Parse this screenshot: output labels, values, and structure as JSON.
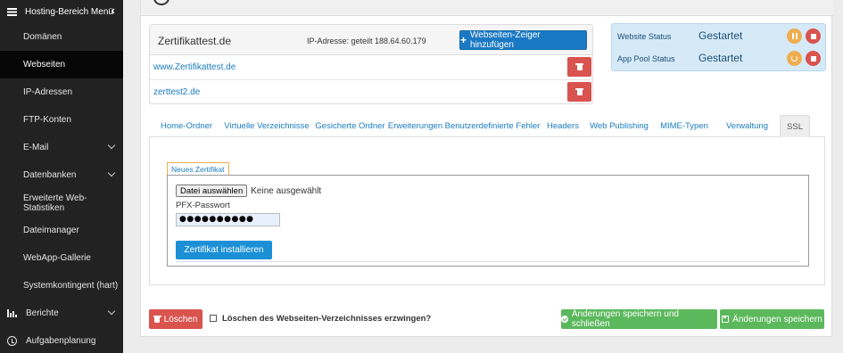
{
  "sidebar": {
    "title": "Hosting-Bereich Menü",
    "items": [
      {
        "label": "Domänen"
      },
      {
        "label": "Webseiten"
      },
      {
        "label": "IP-Adressen"
      },
      {
        "label": "FTP-Konten"
      },
      {
        "label": "E-Mail"
      },
      {
        "label": "Datenbanken"
      },
      {
        "label": "Erweiterte Web-Statistiken"
      },
      {
        "label": "Dateimanager"
      },
      {
        "label": "WebApp-Gallerie"
      },
      {
        "label": "Systemkontingent (hart)"
      },
      {
        "label": "Berichte"
      },
      {
        "label": "Aufgabenplanung"
      }
    ]
  },
  "site": {
    "name": "Zertifikattest.de",
    "ip_text": "IP-Adresse: geteilt 188.64.60.179",
    "add_pointer_label": "Webseiten-Zeiger hinzufügen",
    "pointers": [
      {
        "domain": "www.Zertifikattest.de"
      },
      {
        "domain": "zerttest2.de"
      }
    ]
  },
  "status": {
    "website_label": "Website Status",
    "website_value": "Gestartet",
    "apppool_label": "App Pool Status",
    "apppool_value": "Gestartet"
  },
  "tabs": [
    {
      "label": "Home-Ordner"
    },
    {
      "label": "Virtuelle Verzeichnisse"
    },
    {
      "label": "Gesicherte Ordner"
    },
    {
      "label": "Erweiterungen"
    },
    {
      "label": "Benutzerdefinierte Fehler"
    },
    {
      "label": "Headers"
    },
    {
      "label": "Web Publishing"
    },
    {
      "label": "MIME-Typen"
    },
    {
      "label": "Verwaltung"
    },
    {
      "label": "SSL"
    }
  ],
  "ssl": {
    "cert_tab_label": "Neues Zertifikat",
    "file_button_label": "Datei auswählen",
    "file_status": "Keine ausgewählt",
    "pfx_label": "PFX-Passwort",
    "pfx_value": "●●●●●●●●●●",
    "install_label": "Zertifikat installieren"
  },
  "footer": {
    "delete_label": "Löschen",
    "force_delete_label": "Löschen des Webseiten-Verzeichnisses erzwingen?",
    "save_close_label": "Änderungen speichern und schließen",
    "save_label": "Änderungen speichern"
  },
  "colors": {
    "sidebar_bg": "#222222",
    "primary": "#1b79c3",
    "danger": "#d9534f",
    "success": "#5cb85c",
    "warning": "#f0ad4e",
    "status_bg": "#d5e9f7"
  }
}
